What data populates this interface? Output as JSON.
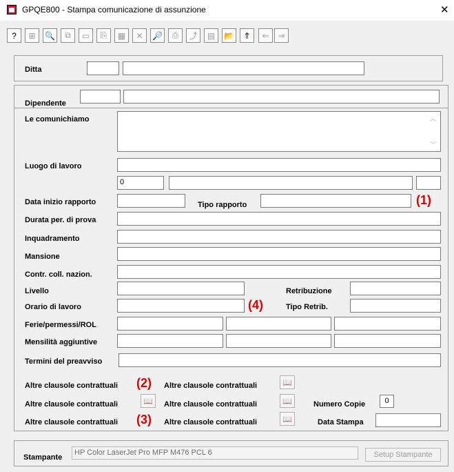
{
  "window": {
    "title": "GPQE800 - Stampa comunicazione di assunzione",
    "close_glyph": "✕"
  },
  "toolbar": {
    "buttons": [
      {
        "icon": "help-icon",
        "glyph": "?"
      },
      {
        "icon": "properties-icon",
        "glyph": "⊞"
      },
      {
        "icon": "binoculars-icon",
        "glyph": "🔍"
      },
      {
        "icon": "copy-icon",
        "glyph": "⧉"
      },
      {
        "icon": "screen-icon",
        "glyph": "▭"
      },
      {
        "icon": "paste-icon",
        "glyph": "⎘"
      },
      {
        "icon": "grid-icon",
        "glyph": "▦"
      },
      {
        "icon": "delete-icon",
        "glyph": "✕"
      },
      {
        "icon": "preview-icon",
        "glyph": "🔎"
      },
      {
        "icon": "print-icon",
        "glyph": "⎙"
      },
      {
        "icon": "export-icon",
        "glyph": "⤴"
      },
      {
        "icon": "form-icon",
        "glyph": "▤"
      },
      {
        "icon": "open-folder-icon",
        "glyph": "📂"
      },
      {
        "icon": "folder-up-icon",
        "glyph": "⇑"
      },
      {
        "icon": "arrow-left-icon",
        "glyph": "⇐"
      },
      {
        "icon": "arrow-right-icon",
        "glyph": "⇒"
      }
    ]
  },
  "ditta": {
    "label": "Ditta",
    "code": "",
    "name": ""
  },
  "dipendente": {
    "label": "Dipendente",
    "code": "",
    "name": ""
  },
  "form": {
    "comunichiamo_label": "Le comunichiamo",
    "luogo_label": "Luogo di lavoro",
    "luogo_cap": "0",
    "data_inizio_label": "Data inizio rapporto",
    "tipo_rapporto_label": "Tipo rapporto",
    "durata_label": "Durata per. di prova",
    "inquadramento_label": "Inquadramento",
    "mansione_label": "Mansione",
    "contratto_label": "Contr. coll. nazion.",
    "livello_label": "Livello",
    "retribuzione_label": "Retribuzione",
    "orario_label": "Orario di lavoro",
    "tipo_retrib_label": "Tipo Retrib.",
    "ferie_label": "Ferie/permessi/ROL",
    "mensilita_label": "Mensilità aggiuntive",
    "preavviso_label": "Termini del preavviso",
    "clausole_label": "Altre clausole contrattuali",
    "numero_copie_label": "Numero Copie",
    "numero_copie_value": "0",
    "data_stampa_label": "Data Stampa"
  },
  "markers": {
    "m1": "(1)",
    "m2": "(2)",
    "m3": "(3)",
    "m4": "(4)"
  },
  "book_glyph": "📖",
  "printer": {
    "label": "Stampante",
    "value": "HP Color LaserJet Pro MFP M476 PCL 6",
    "setup_label": "Setup Stampante"
  }
}
